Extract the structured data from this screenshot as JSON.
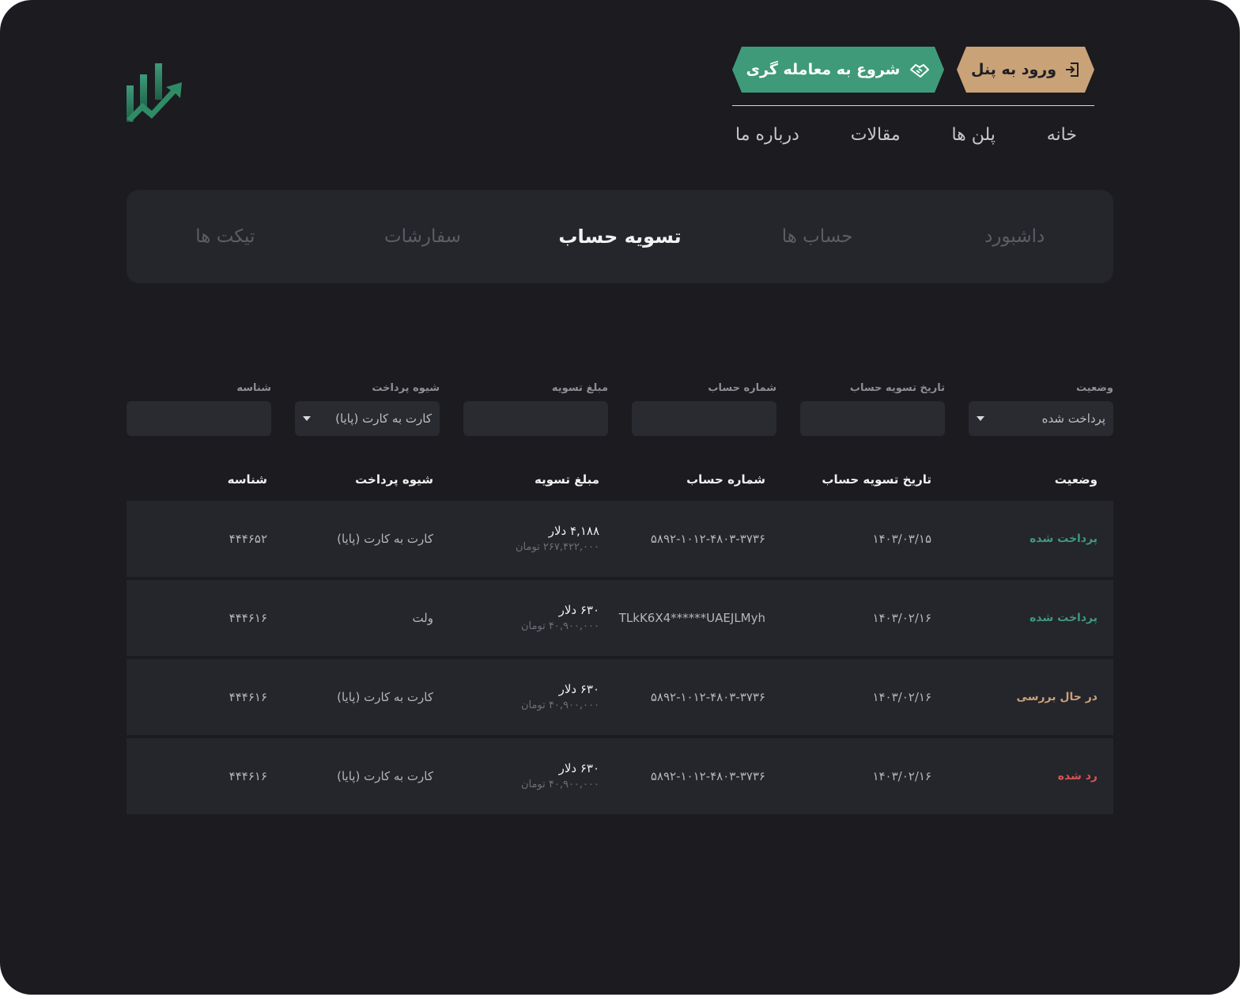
{
  "header": {
    "panel_button": "ورود به پنل",
    "trade_button": "شروع به معامله گری",
    "nav": [
      "خانه",
      "پلن ها",
      "مقالات",
      "درباره ما"
    ]
  },
  "tabs": [
    "داشبورد",
    "حساب ها",
    "تسویه حساب",
    "سفارشات",
    "تیکت ها"
  ],
  "active_tab": "تسویه حساب",
  "filters": {
    "status": {
      "label": "وضعیت",
      "value": "پرداخت شده"
    },
    "date": {
      "label": "تاریخ تسویه حساب",
      "value": ""
    },
    "account": {
      "label": "شماره حساب",
      "value": ""
    },
    "amount": {
      "label": "مبلغ تسویه",
      "value": ""
    },
    "method": {
      "label": "شیوه پرداخت",
      "value": "کارت به کارت (پایا)"
    },
    "id": {
      "label": "شناسه",
      "value": ""
    }
  },
  "table": {
    "headers": [
      "وضعیت",
      "تاریخ تسویه حساب",
      "شماره حساب",
      "مبلغ تسویه",
      "شیوه پرداخت",
      "شناسه"
    ],
    "rows": [
      {
        "status": "پرداخت شده",
        "date": "۱۴۰۳/۰۳/۱۵",
        "account": "۵۸۹۲-۱۰۱۲-۴۸۰۳-۳۷۳۶",
        "amount": "۴,۱۸۸ دلار",
        "amount_toman": "۲۶۷,۴۲۲,۰۰۰ تومان",
        "method": "کارت به کارت (پایا)",
        "id": "۴۴۴۶۵۲"
      },
      {
        "status": "پرداخت شده",
        "date": "۱۴۰۳/۰۲/۱۶",
        "account": "TLkK6X4******UAEJLMyh",
        "amount": "۶۳۰ دلار",
        "amount_toman": "۴۰,۹۰۰,۰۰۰ تومان",
        "method": "ولت",
        "id": "۴۴۴۶۱۶"
      },
      {
        "status": "در حال بررسی",
        "date": "۱۴۰۳/۰۲/۱۶",
        "account": "۵۸۹۲-۱۰۱۲-۴۸۰۳-۳۷۳۶",
        "amount": "۶۳۰ دلار",
        "amount_toman": "۴۰,۹۰۰,۰۰۰ تومان",
        "method": "کارت به کارت (پایا)",
        "id": "۴۴۴۶۱۶"
      },
      {
        "status": "رد شده",
        "date": "۱۴۰۳/۰۲/۱۶",
        "account": "۵۸۹۲-۱۰۱۲-۴۸۰۳-۳۷۳۶",
        "amount": "۶۳۰ دلار",
        "amount_toman": "۴۰,۹۰۰,۰۰۰ تومان",
        "method": "کارت به کارت (پایا)",
        "id": "۴۴۴۶۱۶"
      }
    ]
  },
  "colors": {
    "background": "#1b1b20",
    "panel": "#25252c",
    "accent_green": "#3f9a7a",
    "accent_gold": "#c9a278",
    "status_rejected": "#d9534f"
  },
  "icons": {
    "logo": "chart-bars-arrow-logo",
    "panel_button": "login-icon",
    "trade_button": "handshake-icon",
    "select": "caret-down-icon"
  }
}
